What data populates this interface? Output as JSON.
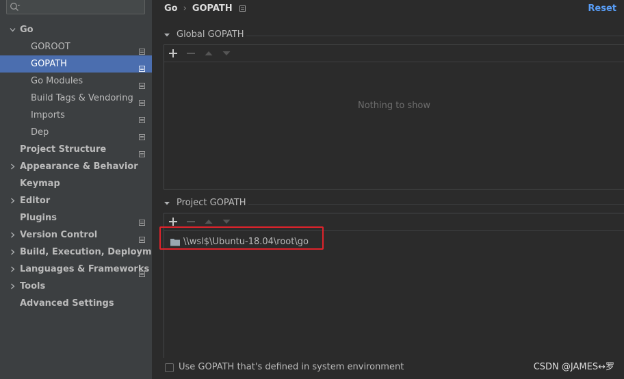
{
  "search": {
    "placeholder": ""
  },
  "sidebar": {
    "items": [
      {
        "label": "Go",
        "level": 0,
        "bold": true,
        "expandable": true,
        "expanded": true,
        "project_icon": false,
        "selected": false
      },
      {
        "label": "GOROOT",
        "level": 1,
        "bold": false,
        "expandable": false,
        "project_icon": true,
        "selected": false
      },
      {
        "label": "GOPATH",
        "level": 1,
        "bold": false,
        "expandable": false,
        "project_icon": true,
        "selected": true
      },
      {
        "label": "Go Modules",
        "level": 1,
        "bold": false,
        "expandable": false,
        "project_icon": true,
        "selected": false
      },
      {
        "label": "Build Tags & Vendoring",
        "level": 1,
        "bold": false,
        "expandable": false,
        "project_icon": true,
        "selected": false
      },
      {
        "label": "Imports",
        "level": 1,
        "bold": false,
        "expandable": false,
        "project_icon": true,
        "selected": false
      },
      {
        "label": "Dep",
        "level": 1,
        "bold": false,
        "expandable": false,
        "project_icon": true,
        "selected": false
      },
      {
        "label": "Project Structure",
        "level": 0,
        "bold": true,
        "expandable": false,
        "project_icon": true,
        "selected": false
      },
      {
        "label": "Appearance & Behavior",
        "level": 0,
        "bold": true,
        "expandable": true,
        "expanded": false,
        "project_icon": false,
        "selected": false
      },
      {
        "label": "Keymap",
        "level": 0,
        "bold": true,
        "expandable": false,
        "project_icon": false,
        "selected": false
      },
      {
        "label": "Editor",
        "level": 0,
        "bold": true,
        "expandable": true,
        "expanded": false,
        "project_icon": false,
        "selected": false
      },
      {
        "label": "Plugins",
        "level": 0,
        "bold": true,
        "expandable": false,
        "project_icon": true,
        "selected": false
      },
      {
        "label": "Version Control",
        "level": 0,
        "bold": true,
        "expandable": true,
        "expanded": false,
        "project_icon": true,
        "selected": false
      },
      {
        "label": "Build, Execution, Deployment",
        "level": 0,
        "bold": true,
        "expandable": true,
        "expanded": false,
        "project_icon": false,
        "selected": false
      },
      {
        "label": "Languages & Frameworks",
        "level": 0,
        "bold": true,
        "expandable": true,
        "expanded": false,
        "project_icon": true,
        "selected": false
      },
      {
        "label": "Tools",
        "level": 0,
        "bold": true,
        "expandable": true,
        "expanded": false,
        "project_icon": false,
        "selected": false
      },
      {
        "label": "Advanced Settings",
        "level": 0,
        "bold": true,
        "expandable": false,
        "project_icon": false,
        "selected": false
      }
    ]
  },
  "header": {
    "breadcrumb_parent": "Go",
    "breadcrumb_separator": "›",
    "breadcrumb_current": "GOPATH",
    "reset_label": "Reset"
  },
  "global_gopath": {
    "title": "Global GOPATH",
    "empty_text": "Nothing to show"
  },
  "project_gopath": {
    "title": "Project GOPATH",
    "paths": [
      "\\\\wsl$\\Ubuntu-18.04\\root\\go"
    ]
  },
  "use_system_gopath": {
    "label": "Use GOPATH that's defined in system environment",
    "checked": false
  },
  "watermark": "CSDN @JAMES↔罗",
  "colors": {
    "accent": "#4b6eaf",
    "link": "#589df6",
    "highlight_box": "#e0232b",
    "background": "#2b2b2b",
    "sidebar": "#3c3f41"
  }
}
